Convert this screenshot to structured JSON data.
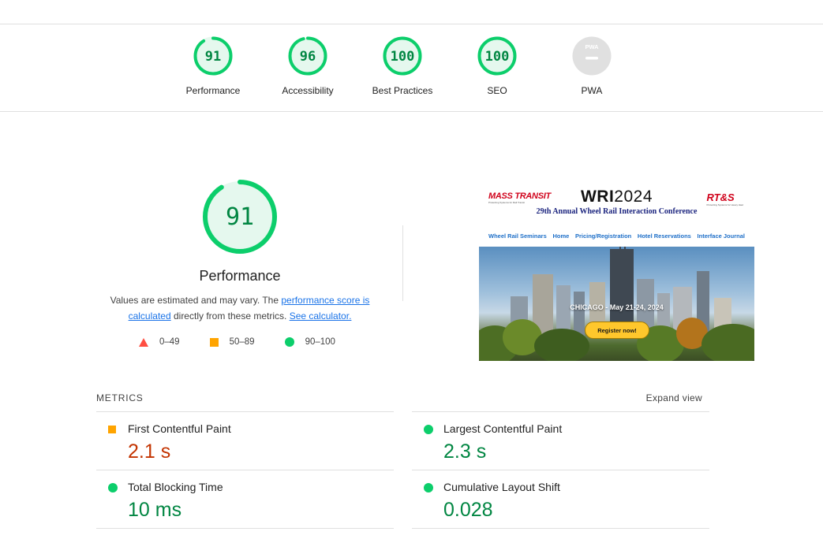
{
  "summary": {
    "gauges": [
      {
        "label": "Performance",
        "score": "91",
        "fraction": 0.91,
        "status": "pass"
      },
      {
        "label": "Accessibility",
        "score": "96",
        "fraction": 0.96,
        "status": "pass"
      },
      {
        "label": "Best Practices",
        "score": "100",
        "fraction": 1.0,
        "status": "pass"
      },
      {
        "label": "SEO",
        "score": "100",
        "fraction": 1.0,
        "status": "pass"
      },
      {
        "label": "PWA",
        "score": "",
        "fraction": 0,
        "status": "na",
        "badge": "PWA"
      }
    ]
  },
  "performance": {
    "score": "91",
    "fraction": 0.91,
    "title": "Performance",
    "desc_prefix": "Values are estimated and may vary. The ",
    "desc_link": "performance score is calculated",
    "desc_middle": " directly from these metrics. ",
    "desc_link2": "See calculator.",
    "legend": [
      {
        "shape": "triangle",
        "range": "0–49"
      },
      {
        "shape": "square",
        "range": "50–89"
      },
      {
        "shape": "circle",
        "range": "90–100"
      }
    ]
  },
  "screenshot": {
    "logo_left": "MASS TRANSIT",
    "logo_left_tag": "Protecting Systems for Rail Transit",
    "title_bold": "WRI",
    "title_year": "2024",
    "logo_right": "RT&S",
    "logo_right_tag": "Protecting Systems for Heavy Haul",
    "conference": "29th Annual Wheel Rail Interaction Conference",
    "nav": [
      "Wheel Rail Seminars",
      "Home",
      "Pricing/Registration",
      "Hotel Reservations",
      "Interface Journal"
    ],
    "caption": "CHICAGO - May 21-24, 2024",
    "button": "Register now!"
  },
  "metrics": {
    "title": "METRICS",
    "expand_label": "Expand view",
    "items": [
      {
        "name": "First Contentful Paint",
        "value": "2.1 s",
        "status": "average"
      },
      {
        "name": "Largest Contentful Paint",
        "value": "2.3 s",
        "status": "pass"
      },
      {
        "name": "Total Blocking Time",
        "value": "10 ms",
        "status": "pass"
      },
      {
        "name": "Cumulative Layout Shift",
        "value": "0.028",
        "status": "pass"
      }
    ]
  },
  "colors": {
    "pass": "#0cce6b",
    "pass_text": "#018642",
    "average": "#ffa400",
    "average_text": "#c33300",
    "fail": "#ff4e42",
    "na": "#e0e0e0",
    "link": "#1a73e8"
  }
}
